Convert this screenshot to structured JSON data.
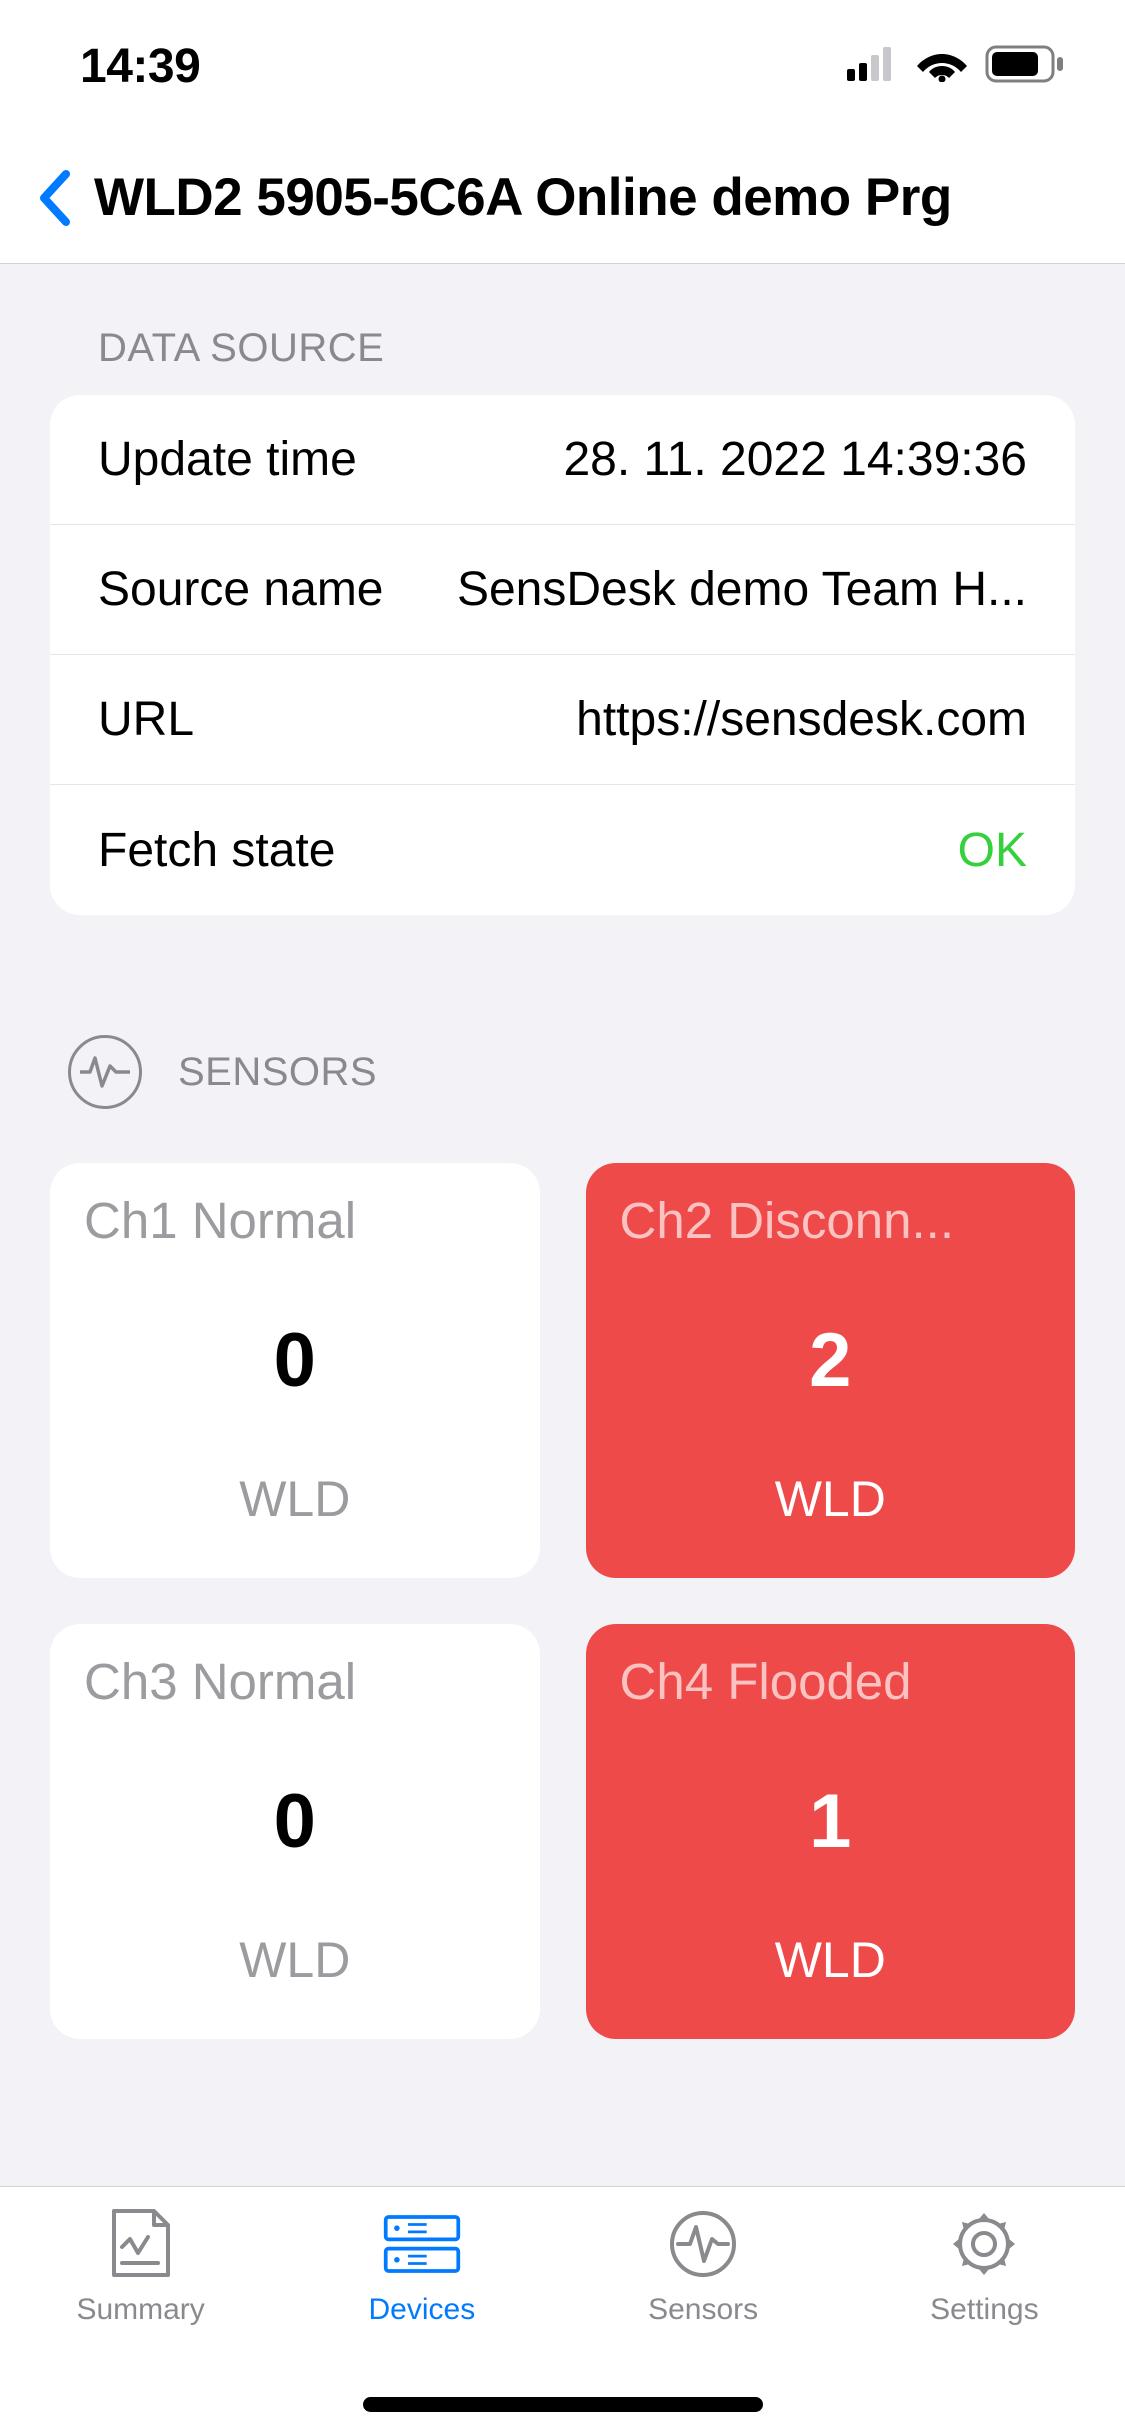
{
  "statusbar": {
    "time": "14:39"
  },
  "header": {
    "title": "WLD2 5905-5C6A Online demo Prg"
  },
  "sections": {
    "datasource": {
      "title": "DATA SOURCE",
      "rows": {
        "update_time": {
          "label": "Update time",
          "value": "28. 11. 2022 14:39:36"
        },
        "source_name": {
          "label": "Source name",
          "value": "SensDesk demo Team H..."
        },
        "url": {
          "label": "URL",
          "value": "https://sensdesk.com"
        },
        "fetch_state": {
          "label": "Fetch state",
          "value": "OK"
        }
      }
    },
    "sensors": {
      "title": "SENSORS",
      "cards": [
        {
          "name": "Ch1 Normal",
          "value": "0",
          "unit": "WLD",
          "alert": false
        },
        {
          "name": "Ch2 Disconn...",
          "value": "2",
          "unit": "WLD",
          "alert": true
        },
        {
          "name": "Ch3 Normal",
          "value": "0",
          "unit": "WLD",
          "alert": false
        },
        {
          "name": "Ch4 Flooded",
          "value": "1",
          "unit": "WLD",
          "alert": true
        }
      ]
    }
  },
  "tabs": {
    "summary": "Summary",
    "devices": "Devices",
    "sensors": "Sensors",
    "settings": "Settings"
  },
  "colors": {
    "accent": "#007aff",
    "alert": "#ef4a4a",
    "ok": "#34d13d"
  }
}
